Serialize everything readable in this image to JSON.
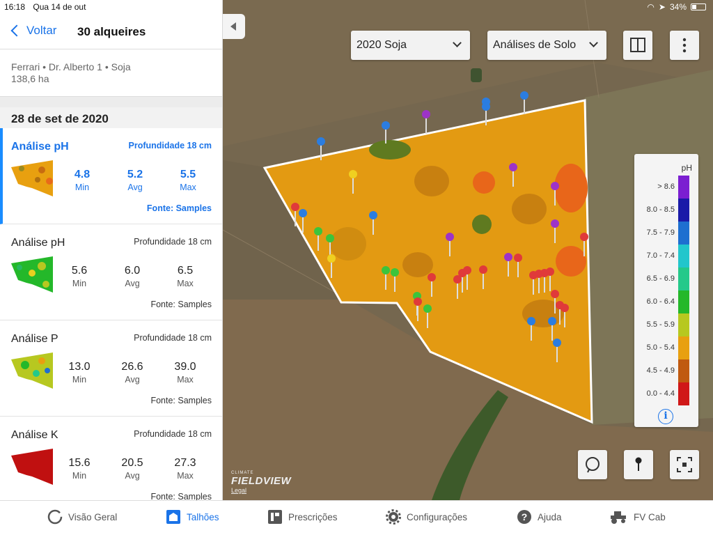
{
  "status": {
    "time": "16:18",
    "date": "Qua 14 de out",
    "battery": "34%"
  },
  "nav": {
    "back_label": "Voltar",
    "title": "30 alqueires"
  },
  "field": {
    "info_line": "Ferrari • Dr. Alberto 1 • Soja",
    "area": "138,6 ha"
  },
  "section_date": "28 de set de 2020",
  "cards": [
    {
      "title": "Análise pH",
      "depth": "Profundidade 18 cm",
      "min": "4.8",
      "avg": "5.2",
      "max": "5.5",
      "min_label": "Min",
      "avg_label": "Avg",
      "max_label": "Max",
      "source": "Fonte: Samples"
    },
    {
      "title": "Análise pH",
      "depth": "Profundidade 18 cm",
      "min": "5.6",
      "avg": "6.0",
      "max": "6.5",
      "min_label": "Min",
      "avg_label": "Avg",
      "max_label": "Max",
      "source": "Fonte: Samples"
    },
    {
      "title": "Análise P",
      "depth": "Profundidade 18 cm",
      "min": "13.0",
      "avg": "26.6",
      "max": "39.0",
      "min_label": "Min",
      "avg_label": "Avg",
      "max_label": "Max",
      "source": "Fonte: Samples"
    },
    {
      "title": "Análise K",
      "depth": "Profundidade 18 cm",
      "min": "15.6",
      "avg": "20.5",
      "max": "27.3",
      "min_label": "Min",
      "avg_label": "Avg",
      "max_label": "Max",
      "source": "Fonte: Samples"
    }
  ],
  "map": {
    "season_select": "2020 Soja",
    "layer_select": "Análises de Solo",
    "legend_unit": "pH",
    "legend": [
      {
        "label": "> 8.6",
        "color": "#7b1fd1"
      },
      {
        "label": "8.0 - 8.5",
        "color": "#1a1aa8"
      },
      {
        "label": "7.5 - 7.9",
        "color": "#1e6fd0"
      },
      {
        "label": "7.0 - 7.4",
        "color": "#22c6cc"
      },
      {
        "label": "6.5 - 6.9",
        "color": "#24c98a"
      },
      {
        "label": "6.0 - 6.4",
        "color": "#24b82a"
      },
      {
        "label": "5.5 - 5.9",
        "color": "#b7c820"
      },
      {
        "label": "5.0 - 5.4",
        "color": "#e8a010"
      },
      {
        "label": "4.5 - 4.9",
        "color": "#c05a10"
      },
      {
        "label": "0.0 - 4.4",
        "color": "#d01818"
      }
    ],
    "brand_small": "CLIMATE",
    "brand": "FIELDVIEW",
    "legal": "Legal"
  },
  "tabs": [
    {
      "label": "Visão Geral",
      "icon": "circle-icon"
    },
    {
      "label": "Talhões",
      "icon": "fields-icon"
    },
    {
      "label": "Prescrições",
      "icon": "prescription-icon"
    },
    {
      "label": "Configurações",
      "icon": "gear-icon"
    },
    {
      "label": "Ajuda",
      "icon": "help-icon"
    },
    {
      "label": "FV Cab",
      "icon": "tractor-icon"
    }
  ]
}
